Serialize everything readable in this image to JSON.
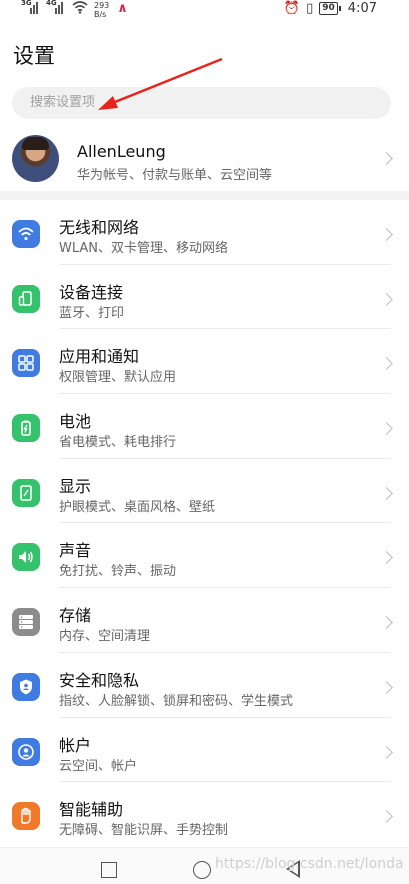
{
  "status_bar": {
    "sim1": "3G",
    "sim2": "4G",
    "speed_value": "293",
    "speed_unit": "B/s",
    "battery": "90",
    "time": "4:07"
  },
  "page": {
    "title": "设置"
  },
  "search": {
    "placeholder": "搜索设置项"
  },
  "profile": {
    "name": "AllenLeung",
    "subtitle": "华为帐号、付款与账单、云空间等"
  },
  "settings": [
    {
      "title": "无线和网络",
      "subtitle": "WLAN、双卡管理、移动网络",
      "icon": "wifi-icon",
      "color": "#3f7be0"
    },
    {
      "title": "设备连接",
      "subtitle": "蓝牙、打印",
      "icon": "device-connection-icon",
      "color": "#35c26d"
    },
    {
      "title": "应用和通知",
      "subtitle": "权限管理、默认应用",
      "icon": "apps-icon",
      "color": "#3f7be0"
    },
    {
      "title": "电池",
      "subtitle": "省电模式、耗电排行",
      "icon": "battery-icon",
      "color": "#35c26d"
    },
    {
      "title": "显示",
      "subtitle": "护眼模式、桌面风格、壁纸",
      "icon": "display-icon",
      "color": "#35c26d"
    },
    {
      "title": "声音",
      "subtitle": "免打扰、铃声、振动",
      "icon": "sound-icon",
      "color": "#35c26d"
    },
    {
      "title": "存储",
      "subtitle": "内存、空间清理",
      "icon": "storage-icon",
      "color": "#8c8c8c"
    },
    {
      "title": "安全和隐私",
      "subtitle": "指纹、人脸解锁、锁屏和密码、学生模式",
      "icon": "shield-icon",
      "color": "#3f7be0"
    },
    {
      "title": "帐户",
      "subtitle": "云空间、帐户",
      "icon": "account-icon",
      "color": "#3f7be0"
    },
    {
      "title": "智能辅助",
      "subtitle": "无障碍、智能识屏、手势控制",
      "icon": "hand-icon",
      "color": "#f07a2a"
    }
  ],
  "watermark": "https://blog.csdn.net/londa"
}
